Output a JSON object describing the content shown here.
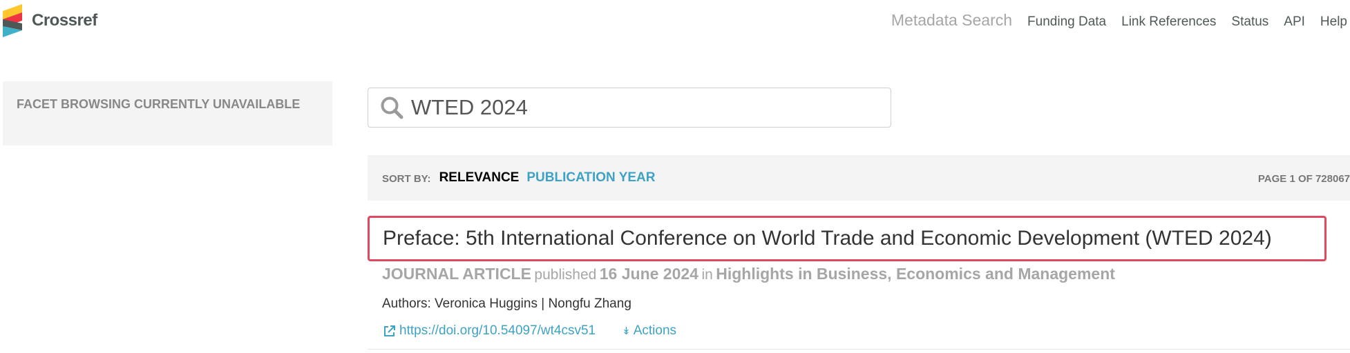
{
  "brand": {
    "name": "Crossref",
    "colors": {
      "yellow": "#ffc72c",
      "red": "#ef3340",
      "blue": "#3eb1c8",
      "dark": "#4f5858"
    }
  },
  "nav": {
    "metadata_search": "Metadata Search",
    "funding_data": "Funding Data",
    "link_references": "Link References",
    "status": "Status",
    "api": "API",
    "help": "Help"
  },
  "facets": {
    "message": "FACET BROWSING CURRENTLY UNAVAILABLE"
  },
  "search": {
    "value": "WTED 2024",
    "icon": "search-icon"
  },
  "sort": {
    "label": "SORT BY:",
    "active": "RELEVANCE",
    "option": "PUBLICATION YEAR",
    "page_info": "PAGE 1 OF 728067"
  },
  "result": {
    "title": "Preface: 5th International Conference on World Trade and Economic Development (WTED 2024)",
    "type": "JOURNAL ARTICLE",
    "published_label": "published",
    "date": "16 June 2024",
    "in_label": "in",
    "journal": "Highlights in Business, Economics and Management",
    "authors": "Authors: Veronica Huggins | Nongfu Zhang",
    "doi": "https://doi.org/10.54097/wt4csv51",
    "actions": "Actions",
    "highlight_color": "#e0485f"
  },
  "link_color": "#3ea2c5"
}
